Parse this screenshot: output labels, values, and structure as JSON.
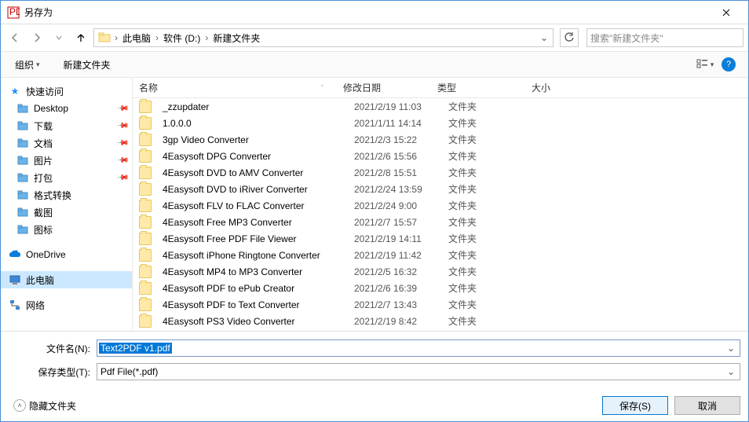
{
  "title": "另存为",
  "breadcrumb": [
    "此电脑",
    "软件 (D:)",
    "新建文件夹"
  ],
  "search_placeholder": "搜索\"新建文件夹\"",
  "toolbar": {
    "organize": "组织",
    "new_folder": "新建文件夹"
  },
  "columns": {
    "name": "名称",
    "date": "修改日期",
    "type": "类型",
    "size": "大小"
  },
  "sidebar": {
    "quick": "快速访问",
    "items": [
      {
        "label": "Desktop",
        "pinned": true
      },
      {
        "label": "下载",
        "pinned": true
      },
      {
        "label": "文档",
        "pinned": true
      },
      {
        "label": "图片",
        "pinned": true
      },
      {
        "label": "打包",
        "pinned": true
      },
      {
        "label": "格式转换",
        "pinned": false
      },
      {
        "label": "截图",
        "pinned": false
      },
      {
        "label": "图标",
        "pinned": false
      }
    ],
    "onedrive": "OneDrive",
    "thispc": "此电脑",
    "network": "网络"
  },
  "files": [
    {
      "name": "_zzupdater",
      "date": "2021/2/19 11:03",
      "type": "文件夹"
    },
    {
      "name": "1.0.0.0",
      "date": "2021/1/11 14:14",
      "type": "文件夹"
    },
    {
      "name": "3gp Video Converter",
      "date": "2021/2/3 15:22",
      "type": "文件夹"
    },
    {
      "name": "4Easysoft DPG Converter",
      "date": "2021/2/6 15:56",
      "type": "文件夹"
    },
    {
      "name": "4Easysoft DVD to AMV Converter",
      "date": "2021/2/8 15:51",
      "type": "文件夹"
    },
    {
      "name": "4Easysoft DVD to iRiver Converter",
      "date": "2021/2/24 13:59",
      "type": "文件夹"
    },
    {
      "name": "4Easysoft FLV to FLAC Converter",
      "date": "2021/2/24 9:00",
      "type": "文件夹"
    },
    {
      "name": "4Easysoft Free MP3 Converter",
      "date": "2021/2/7 15:57",
      "type": "文件夹"
    },
    {
      "name": "4Easysoft Free PDF File Viewer",
      "date": "2021/2/19 14:11",
      "type": "文件夹"
    },
    {
      "name": "4Easysoft iPhone Ringtone Converter",
      "date": "2021/2/19 11:42",
      "type": "文件夹"
    },
    {
      "name": "4Easysoft MP4 to MP3 Converter",
      "date": "2021/2/5 16:32",
      "type": "文件夹"
    },
    {
      "name": "4Easysoft PDF to ePub Creator",
      "date": "2021/2/6 16:39",
      "type": "文件夹"
    },
    {
      "name": "4Easysoft PDF to Text Converter",
      "date": "2021/2/7 13:43",
      "type": "文件夹"
    },
    {
      "name": "4Easysoft PS3 Video Converter",
      "date": "2021/2/19 8:42",
      "type": "文件夹"
    }
  ],
  "filename_label": "文件名(N):",
  "filename_value": "Text2PDF v1.pdf",
  "filetype_label": "保存类型(T):",
  "filetype_value": "Pdf File(*.pdf)",
  "hide_folders": "隐藏文件夹",
  "save_btn": "保存(S)",
  "cancel_btn": "取消"
}
